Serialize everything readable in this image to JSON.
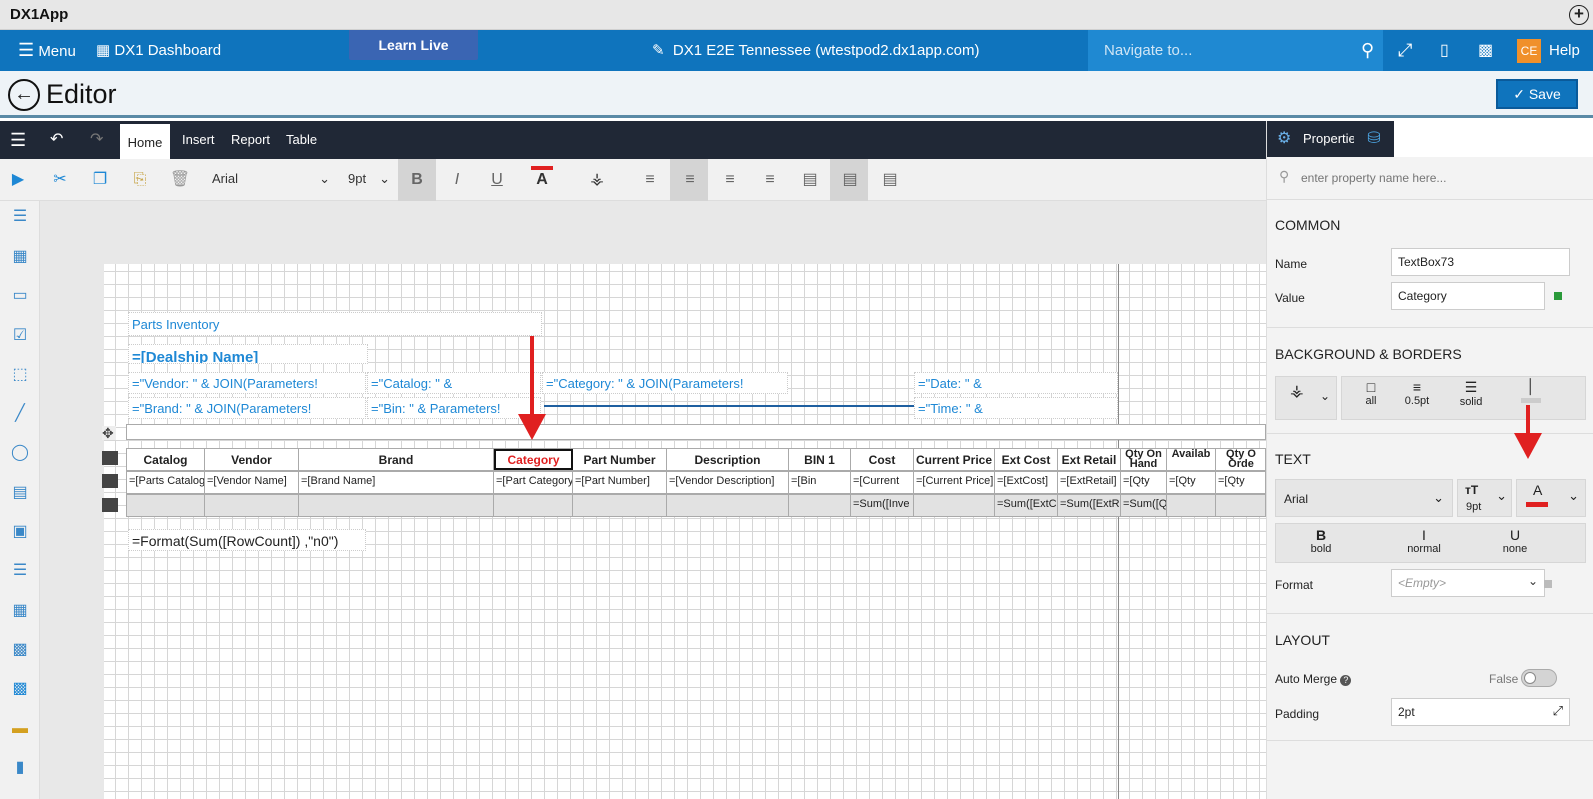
{
  "app": {
    "title": "DX1App"
  },
  "topnav": {
    "menu_label": "Menu",
    "dashboard_label": "DX1 Dashboard",
    "learn_live_label": "Learn Live",
    "site_label": "DX1 E2E Tennessee (wtestpod2.dx1app.com)",
    "navigate_placeholder": "Navigate to...",
    "user_initials": "CE",
    "help_label": "Help"
  },
  "editor": {
    "title": "Editor",
    "save_label": "Save"
  },
  "ribbon": {
    "tabs": [
      "Home",
      "Insert",
      "Report",
      "Table"
    ],
    "active_tab": "Home"
  },
  "toolbar": {
    "font": "Arial",
    "size": "9pt"
  },
  "report": {
    "title": "Parts Inventory",
    "dealership": "=[Dealship Name]",
    "params": {
      "vendor": "=\"Vendor: \" & JOIN(Parameters!",
      "catalog": "=\"Catalog: \" &",
      "category": "=\"Category: \" & JOIN(Parameters!",
      "date": "=\"Date: \" &",
      "brand": "=\"Brand: \" & JOIN(Parameters!",
      "bin": "=\"Bin: \" & Parameters!",
      "time": "=\"Time: \" &"
    },
    "headers": [
      "Catalog",
      "Vendor",
      "Brand",
      "Category",
      "Part Number",
      "Description",
      "BIN 1",
      "Cost",
      "Current Price",
      "Ext Cost",
      "Ext Retail",
      "Qty On Hand",
      "Availab",
      "Qty O Orde"
    ],
    "detail": [
      "=[Parts Catalog",
      "=[Vendor Name]",
      "=[Brand Name]",
      "=[Part Category",
      "=[Part Number]",
      "=[Vendor Description]",
      "=[Bin",
      "=[Current",
      "=[Current Price]",
      "=[ExtCost]",
      "=[ExtRetail]",
      "=[Qty",
      "=[Qty",
      "=[Qty"
    ],
    "totals": [
      "",
      "",
      "",
      "",
      "",
      "",
      "",
      "=Sum([Inve",
      "",
      "=Sum([ExtC",
      "=Sum([ExtR",
      "=Sum([Q",
      "",
      ""
    ],
    "footer": "=Format(Sum([RowCount]) ,\"n0\")"
  },
  "properties": {
    "tab_label": "Properties",
    "search_placeholder": "enter property name here...",
    "common": {
      "header": "COMMON",
      "name_label": "Name",
      "name_value": "TextBox73",
      "value_label": "Value",
      "value_value": "Category"
    },
    "bg": {
      "header": "BACKGROUND & BORDERS",
      "border_all": "all",
      "border_width": "0.5pt",
      "border_style": "solid"
    },
    "text": {
      "header": "TEXT",
      "font": "Arial",
      "size": "9pt",
      "weight_icon": "B",
      "weight_label": "bold",
      "style_icon": "I",
      "style_label": "normal",
      "decoration_icon": "U",
      "decoration_label": "none",
      "format_label": "Format",
      "format_value": "<Empty>"
    },
    "layout": {
      "header": "LAYOUT",
      "auto_merge_label": "Auto Merge",
      "auto_merge_value": "False",
      "padding_label": "Padding",
      "padding_value": "2pt"
    }
  },
  "colors": {
    "nav_blue": "#0f74bd",
    "dark_bar": "#202836",
    "highlight_red": "#e02020"
  }
}
